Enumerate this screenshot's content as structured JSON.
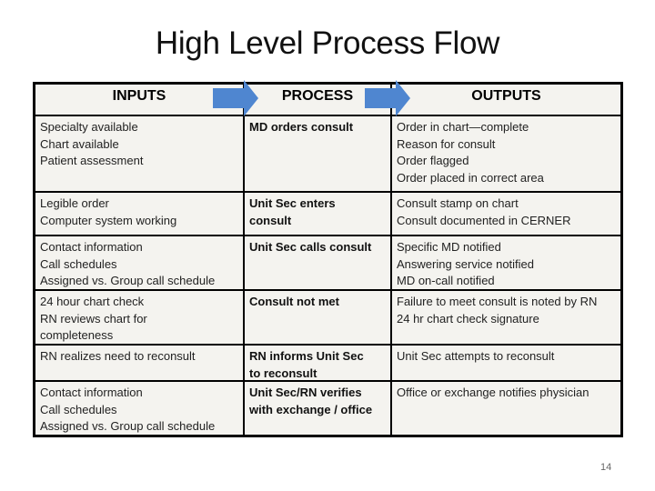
{
  "slide": {
    "title": "High Level Process Flow",
    "page_number": "14"
  },
  "table": {
    "headers": [
      "INPUTS",
      "PROCESS",
      "OUTPUTS"
    ],
    "arrow_color": "#4f86d0",
    "rows": [
      {
        "inputs": [
          "Specialty available",
          "Chart available",
          "Patient assessment"
        ],
        "process": [
          "MD orders  consult"
        ],
        "outputs": [
          "Order in chart—complete",
          "Reason for consult",
          "Order flagged",
          "Order placed in correct area"
        ]
      },
      {
        "inputs": [
          "Legible order",
          "Computer system working"
        ],
        "process": [
          "Unit Sec enters",
          "consult"
        ],
        "outputs": [
          "Consult stamp on chart",
          "Consult documented in CERNER"
        ]
      },
      {
        "inputs": [
          "Contact information",
          "Call schedules",
          "Assigned vs. Group call schedule"
        ],
        "process": [
          "Unit Sec calls consult"
        ],
        "outputs": [
          "Specific MD notified",
          "Answering service notified",
          "MD on-call notified"
        ]
      },
      {
        "inputs": [
          "24 hour chart check",
          "RN reviews chart for",
          "completeness"
        ],
        "process": [
          "Consult not met"
        ],
        "outputs": [
          "Failure to meet consult is noted by RN",
          "24 hr chart check signature"
        ]
      },
      {
        "inputs": [
          "RN realizes need to reconsult"
        ],
        "process": [
          "RN informs Unit Sec",
          "to reconsult"
        ],
        "outputs": [
          "Unit Sec attempts to reconsult"
        ]
      },
      {
        "inputs": [
          "Contact information",
          "Call schedules",
          "Assigned vs. Group call schedule"
        ],
        "process": [
          "Unit Sec/RN verifies",
          "with exchange / office"
        ],
        "outputs": [
          "Office or exchange notifies physician"
        ]
      }
    ]
  }
}
